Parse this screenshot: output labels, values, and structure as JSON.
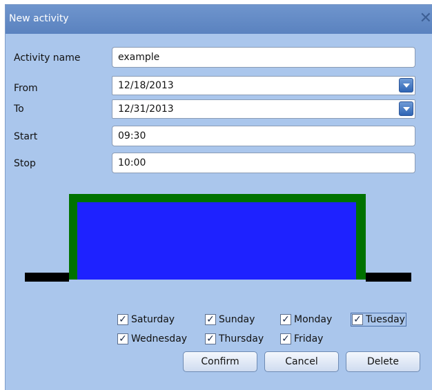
{
  "dialog": {
    "title": "New activity"
  },
  "form": {
    "activity_name_label": "Activity name",
    "activity_name_value": "example",
    "from_label": "From",
    "from_value": "12/18/2013",
    "to_label": "To",
    "to_value": "12/31/2013",
    "start_label": "Start",
    "start_value": "09:30",
    "stop_label": "Stop",
    "stop_value": "10:00"
  },
  "days": [
    {
      "label": "Saturday",
      "checked": true
    },
    {
      "label": "Sunday",
      "checked": true
    },
    {
      "label": "Monday",
      "checked": true
    },
    {
      "label": "Tuesday",
      "checked": true
    },
    {
      "label": "Wednesday",
      "checked": true
    },
    {
      "label": "Thursday",
      "checked": true
    },
    {
      "label": "Friday",
      "checked": true
    }
  ],
  "buttons": {
    "confirm": "Confirm",
    "cancel": "Cancel",
    "delete": "Delete"
  },
  "colors": {
    "dialog_bg": "#aac6ec",
    "title_bg": "#5f88c4",
    "activity_fill": "#1e22ff",
    "activity_border": "#007200",
    "timeline": "#000000"
  },
  "icons": {
    "close": "close-icon",
    "dropdown": "chevron-down-icon",
    "check": "checkmark-icon"
  }
}
